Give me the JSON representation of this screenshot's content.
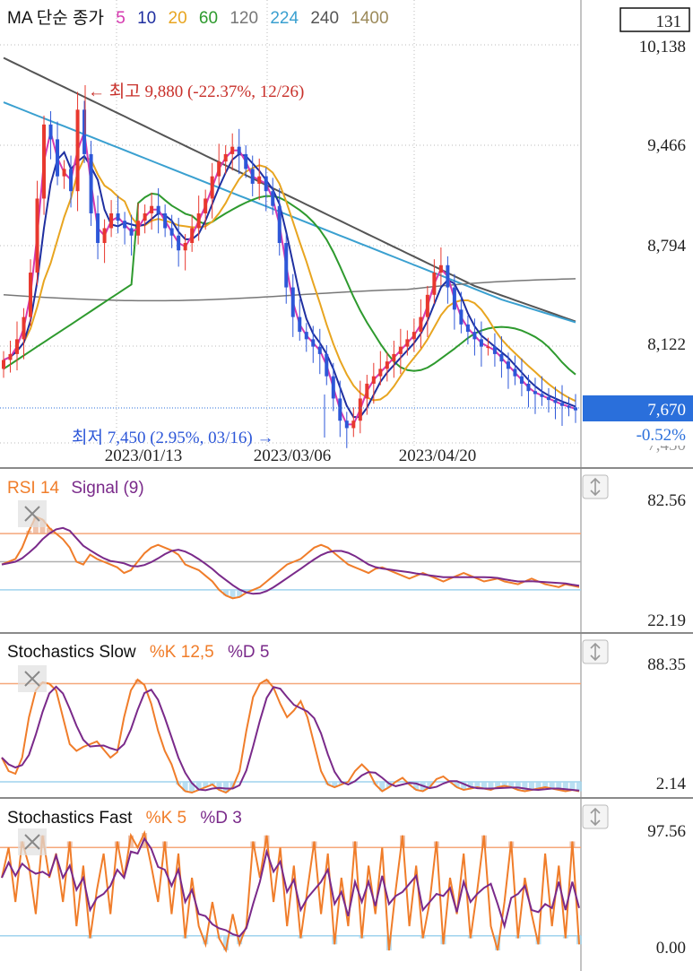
{
  "legend": {
    "title": "MA 단순 종가",
    "periods": [
      {
        "label": "5",
        "color": "#d63ab0"
      },
      {
        "label": "10",
        "color": "#1f2fa0"
      },
      {
        "label": "20",
        "color": "#e8a520"
      },
      {
        "label": "60",
        "color": "#2e9a2e"
      },
      {
        "label": "120",
        "color": "#777777"
      },
      {
        "label": "224",
        "color": "#3aa0d0"
      },
      {
        "label": "240",
        "color": "#555555"
      },
      {
        "label": "1400",
        "color": "#9c8a5a"
      }
    ]
  },
  "top_box_value": "131",
  "price_axis": {
    "ticks": [
      "10,138",
      "9,466",
      "8,794",
      "8,122"
    ],
    "current": "7,670",
    "current_change": "-0.52%",
    "bottom_partial": "7,450"
  },
  "annotations": {
    "high": "← 최고 9,880 (-22.37%, 12/26)",
    "low": "최저 7,450 (2.95%, 03/16) →"
  },
  "x_dates": [
    "2023/01/13",
    "2023/03/06",
    "2023/04/20"
  ],
  "rsi": {
    "title": "RSI 14",
    "signal": "Signal (9)",
    "max": "82.56",
    "min": "22.19"
  },
  "stoch_slow": {
    "title": "Stochastics Slow",
    "k": "%K 12,5",
    "d": "%D 5",
    "max": "88.35",
    "min": "2.14"
  },
  "stoch_fast": {
    "title": "Stochastics Fast",
    "k": "%K 5",
    "d": "%D 3",
    "max": "97.56",
    "min": "0.00"
  },
  "colors": {
    "up": "#e8382e",
    "down": "#2d57d8",
    "rsi": "#f07d2a",
    "signal": "#7a2a8a",
    "overbought": "#f5a77a",
    "oversold": "#9fd3ee",
    "mid": "#b0b0b0",
    "current_bg": "#2a6fdb"
  },
  "chart_data": {
    "type": "candlestick",
    "xlabel": "",
    "ylabel": "",
    "x_ticks": [
      "2023/01/13",
      "2023/03/06",
      "2023/04/20"
    ],
    "ylim": [
      7450,
      10138
    ],
    "anchor_points": [
      {
        "x": "12/26",
        "y": 9880,
        "note": "최고"
      },
      {
        "x": "03/16",
        "y": 7450,
        "note": "최저"
      },
      {
        "x": "last",
        "y": 7670,
        "note": "current"
      }
    ],
    "candle_close_trend": [
      8010,
      8050,
      8150,
      8300,
      8600,
      9100,
      9600,
      9500,
      9250,
      9300,
      9150,
      9700,
      9400,
      9000,
      8800,
      8900,
      9000,
      8950,
      8900,
      8850,
      8950,
      9000,
      9050,
      9000,
      8900,
      8850,
      8750,
      8800,
      8900,
      9000,
      9100,
      9250,
      9350,
      9400,
      9450,
      9400,
      9300,
      9200,
      9250,
      9150,
      9050,
      8800,
      8500,
      8300,
      8200,
      8150,
      8100,
      8050,
      7900,
      7750,
      7600,
      7550,
      7600,
      7750,
      7850,
      7900,
      7950,
      8000,
      8050,
      8100,
      8150,
      8200,
      8300,
      8450,
      8600,
      8650,
      8500,
      8350,
      8250,
      8200,
      8150,
      8100,
      8100,
      8050,
      8000,
      7950,
      7900,
      7850,
      7800,
      7780,
      7760,
      7740,
      7720,
      7700,
      7690,
      7670
    ],
    "ma_period_labels": [
      "5",
      "10",
      "20",
      "60",
      "120",
      "224",
      "240",
      "1400"
    ],
    "rsi": {
      "ylim": [
        22.19,
        82.56
      ],
      "series": [
        {
          "name": "RSI 14"
        },
        {
          "name": "Signal (9)"
        }
      ]
    },
    "stochastics_slow": {
      "ylim": [
        2.14,
        88.35
      ],
      "series": [
        {
          "name": "%K 12,5"
        },
        {
          "name": "%D 5"
        }
      ]
    },
    "stochastics_fast": {
      "ylim": [
        0.0,
        97.56
      ],
      "series": [
        {
          "name": "%K 5"
        },
        {
          "name": "%D 3"
        }
      ]
    }
  }
}
